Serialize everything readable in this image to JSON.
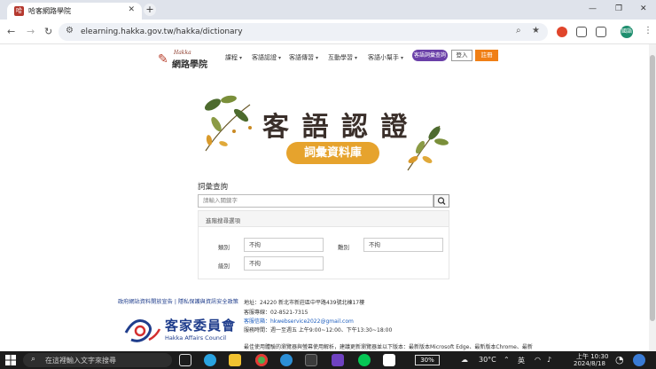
{
  "browser": {
    "tab_title": "哈客網路學院",
    "tab_favicon": "哈",
    "url": "elearning.hakka.gov.tw/hakka/dictionary",
    "profile_initials": "國語"
  },
  "site": {
    "logo_sub": "Hakka",
    "logo_name": "網路學院",
    "menu": [
      "課程",
      "客語認證",
      "客語傳習",
      "互動學習",
      "客語小幫手"
    ],
    "dict_button": "客語詞彙查詢",
    "login_button": "登入",
    "register_button": "註冊"
  },
  "banner": {
    "title": "客 語 認 證",
    "subtitle": "詞彙資料庫"
  },
  "search": {
    "label": "詞彙查詢",
    "placeholder": "請輸入關鍵字",
    "advanced_header": "進階搜尋選項",
    "fields": [
      {
        "label": "類別",
        "value": "不拘"
      },
      {
        "label": "難別",
        "value": "不拘"
      },
      {
        "label": "級別",
        "value": "不拘"
      }
    ]
  },
  "footer": {
    "links": "政府網站資料開放宣告 | 隱私保護與資訊安全政策",
    "address": "地址：24220 新北市新莊區中平路439號北棟17樓",
    "phone": "客服專線：02-8521-7315",
    "email": "客服信箱：hkwebservice2022@gmail.com",
    "hours": "服務時間：週一至週五 上午9:00~12:00、下午13:30~18:00",
    "notice": "最佳使用體驗的瀏覽器與螢幕使用解析，建議更新瀏覽器並以下版本：最新版本Microsoft Edge、最新版本Chrome、最新",
    "council_zh": "客家委員會",
    "council_en": "Hakka Affairs Council"
  },
  "taskbar": {
    "search_placeholder": "在這裡輸入文字來搜尋",
    "battery": "30%",
    "weather": "30°C",
    "ime": "英",
    "time": "上午 10:30",
    "date": "2024/8/18"
  }
}
